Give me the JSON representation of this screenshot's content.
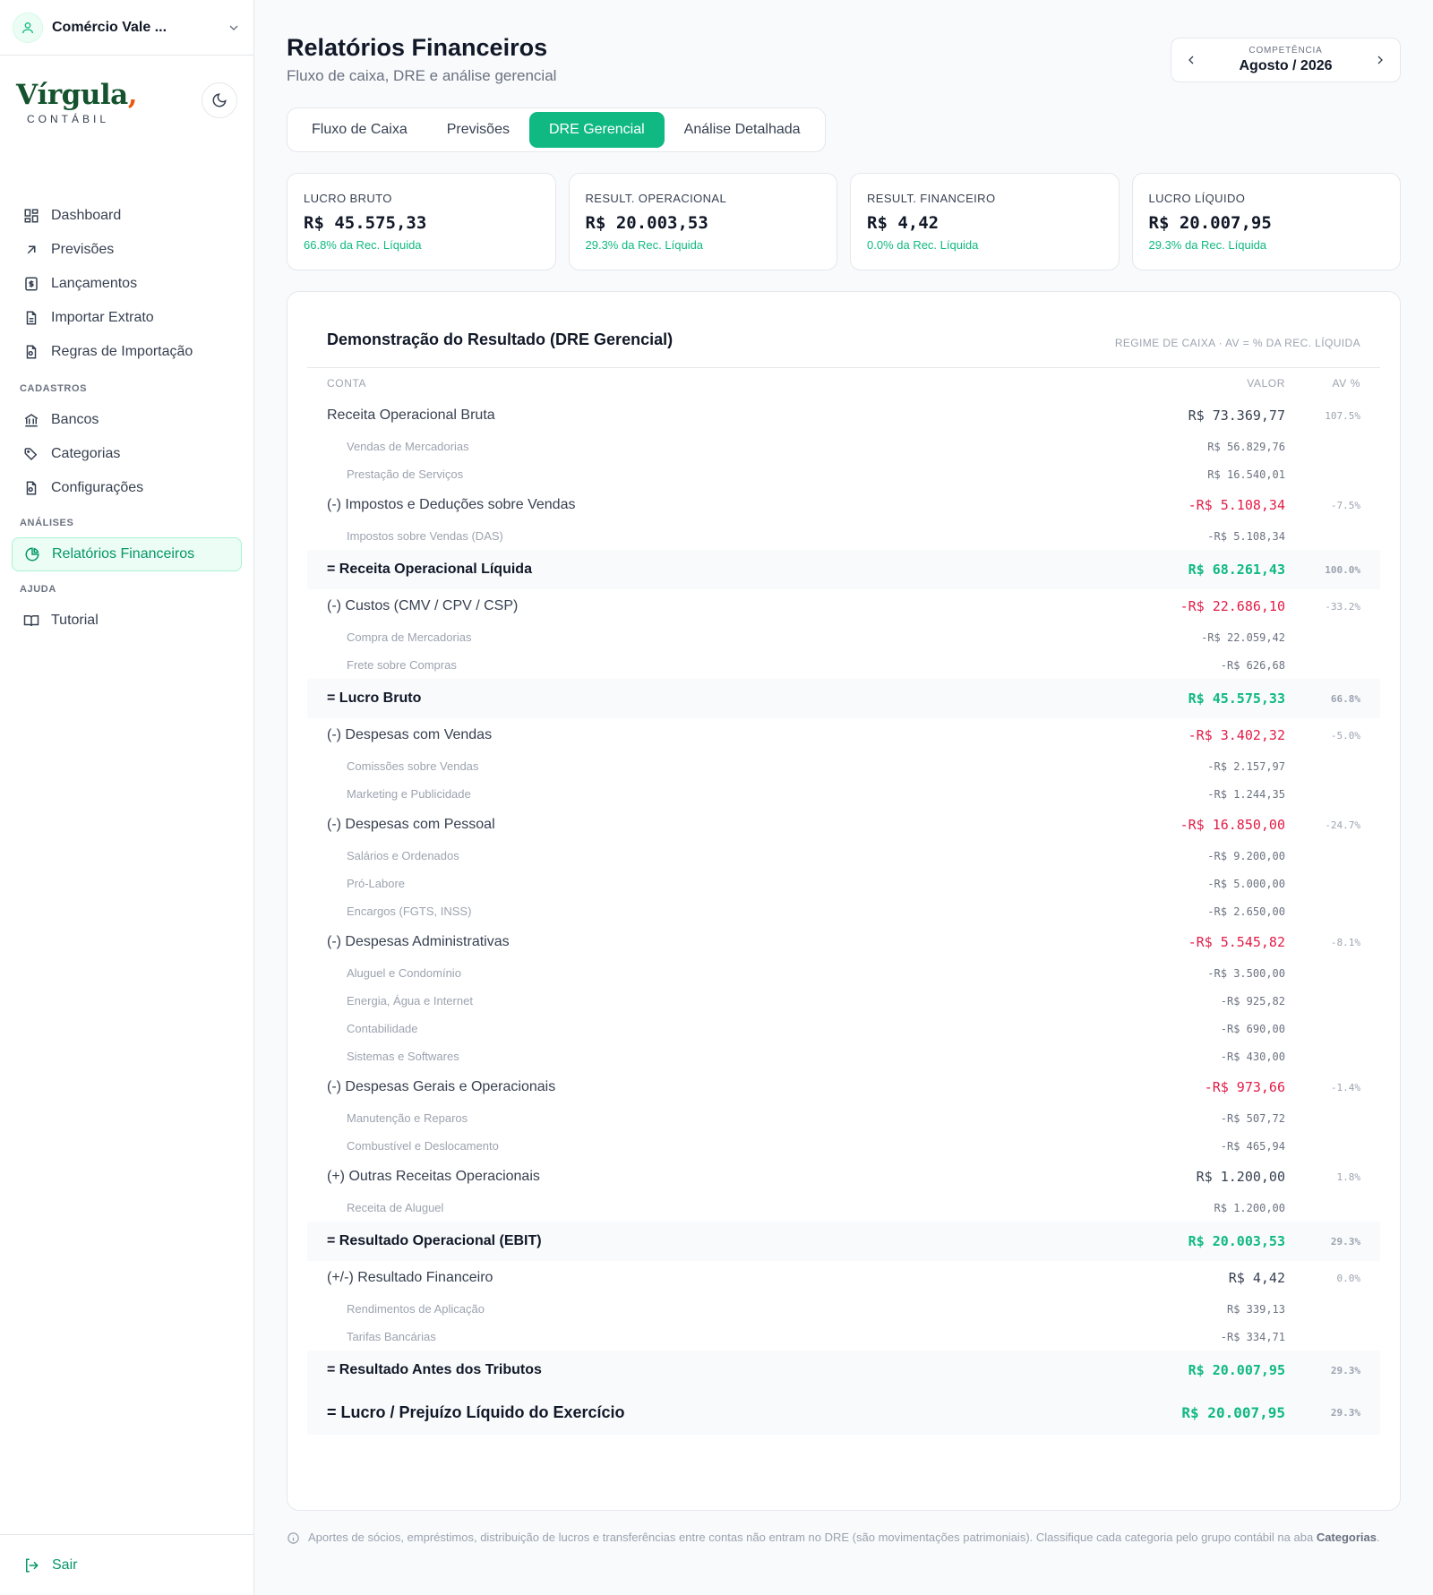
{
  "sidebar": {
    "company": "Comércio Vale ...",
    "brand": {
      "logo": "Vírgula",
      "comma": ",",
      "sub": "CONTÁBIL"
    },
    "items": [
      {
        "label": "Dashboard",
        "icon": "grid-icon"
      },
      {
        "label": "Previsões",
        "icon": "arrow-up-right-icon"
      },
      {
        "label": "Lançamentos",
        "icon": "dollar-doc-icon"
      },
      {
        "label": "Importar Extrato",
        "icon": "file-icon"
      },
      {
        "label": "Regras de Importação",
        "icon": "file-rules-icon"
      }
    ],
    "sections": {
      "cadastros": "CADASTROS",
      "analises": "ANÁLISES",
      "ajuda": "AJUDA"
    },
    "cadastros": [
      {
        "label": "Bancos",
        "icon": "bank-icon"
      },
      {
        "label": "Categorias",
        "icon": "tags-icon"
      },
      {
        "label": "Configurações",
        "icon": "settings-file-icon"
      }
    ],
    "analises": [
      {
        "label": "Relatórios Financeiros",
        "icon": "pie-chart-icon",
        "active": true
      }
    ],
    "ajuda": [
      {
        "label": "Tutorial",
        "icon": "book-icon"
      }
    ],
    "logout": "Sair"
  },
  "header": {
    "title": "Relatórios Financeiros",
    "subtitle": "Fluxo de caixa, DRE e análise gerencial",
    "period_label": "COMPETÊNCIA",
    "period_value": "Agosto / 2026"
  },
  "tabs": [
    "Fluxo de Caixa",
    "Previsões",
    "DRE Gerencial",
    "Análise Detalhada"
  ],
  "cards": [
    {
      "label": "LUCRO BRUTO",
      "value": "R$ 45.575,33",
      "note": "66.8% da Rec. Líquida"
    },
    {
      "label": "RESULT. OPERACIONAL",
      "value": "R$ 20.003,53",
      "note": "29.3% da Rec. Líquida"
    },
    {
      "label": "RESULT. FINANCEIRO",
      "value": "R$ 4,42",
      "note": "0.0% da Rec. Líquida"
    },
    {
      "label": "LUCRO LÍQUIDO",
      "value": "R$ 20.007,95",
      "note": "29.3% da Rec. Líquida"
    }
  ],
  "dre": {
    "title": "Demonstração do Resultado (DRE Gerencial)",
    "regime": "REGIME DE CAIXA · AV = % DA REC. LÍQUIDA",
    "col_account": "CONTA",
    "col_value": "VALOR",
    "col_av": "AV %",
    "rows": [
      {
        "type": "group",
        "label": "Receita Operacional Bruta",
        "value": "R$ 73.369,77",
        "av": "107.5%"
      },
      {
        "type": "sub",
        "label": "Vendas de Mercadorias",
        "value": "R$ 56.829,76"
      },
      {
        "type": "sub",
        "label": "Prestação de Serviços",
        "value": "R$ 16.540,01"
      },
      {
        "type": "group",
        "label": "(-) Impostos e Deduções sobre Vendas",
        "value": "-R$ 5.108,34",
        "av": "-7.5%",
        "neg": true
      },
      {
        "type": "sub",
        "label": "Impostos sobre Vendas (DAS)",
        "value": "-R$ 5.108,34"
      },
      {
        "type": "total",
        "label": "= Receita Operacional Líquida",
        "value": "R$ 68.261,43",
        "av": "100.0%"
      },
      {
        "type": "group",
        "label": "(-) Custos (CMV / CPV / CSP)",
        "value": "-R$ 22.686,10",
        "av": "-33.2%",
        "neg": true
      },
      {
        "type": "sub",
        "label": "Compra de Mercadorias",
        "value": "-R$ 22.059,42"
      },
      {
        "type": "sub",
        "label": "Frete sobre Compras",
        "value": "-R$ 626,68"
      },
      {
        "type": "total",
        "label": "= Lucro Bruto",
        "value": "R$ 45.575,33",
        "av": "66.8%"
      },
      {
        "type": "group",
        "label": "(-) Despesas com Vendas",
        "value": "-R$ 3.402,32",
        "av": "-5.0%",
        "neg": true
      },
      {
        "type": "sub",
        "label": "Comissões sobre Vendas",
        "value": "-R$ 2.157,97"
      },
      {
        "type": "sub",
        "label": "Marketing e Publicidade",
        "value": "-R$ 1.244,35"
      },
      {
        "type": "group",
        "label": "(-) Despesas com Pessoal",
        "value": "-R$ 16.850,00",
        "av": "-24.7%",
        "neg": true
      },
      {
        "type": "sub",
        "label": "Salários e Ordenados",
        "value": "-R$ 9.200,00"
      },
      {
        "type": "sub",
        "label": "Pró-Labore",
        "value": "-R$ 5.000,00"
      },
      {
        "type": "sub",
        "label": "Encargos (FGTS, INSS)",
        "value": "-R$ 2.650,00"
      },
      {
        "type": "group",
        "label": "(-) Despesas Administrativas",
        "value": "-R$ 5.545,82",
        "av": "-8.1%",
        "neg": true
      },
      {
        "type": "sub",
        "label": "Aluguel e Condomínio",
        "value": "-R$ 3.500,00"
      },
      {
        "type": "sub",
        "label": "Energia, Água e Internet",
        "value": "-R$ 925,82"
      },
      {
        "type": "sub",
        "label": "Contabilidade",
        "value": "-R$ 690,00"
      },
      {
        "type": "sub",
        "label": "Sistemas e Softwares",
        "value": "-R$ 430,00"
      },
      {
        "type": "group",
        "label": "(-) Despesas Gerais e Operacionais",
        "value": "-R$ 973,66",
        "av": "-1.4%",
        "neg": true
      },
      {
        "type": "sub",
        "label": "Manutenção e Reparos",
        "value": "-R$ 507,72"
      },
      {
        "type": "sub",
        "label": "Combustível e Deslocamento",
        "value": "-R$ 465,94"
      },
      {
        "type": "group",
        "label": "(+) Outras Receitas Operacionais",
        "value": "R$ 1.200,00",
        "av": "1.8%"
      },
      {
        "type": "sub",
        "label": "Receita de Aluguel",
        "value": "R$ 1.200,00"
      },
      {
        "type": "total",
        "label": "= Resultado Operacional (EBIT)",
        "value": "R$ 20.003,53",
        "av": "29.3%"
      },
      {
        "type": "group",
        "label": "(+/-) Resultado Financeiro",
        "value": "R$ 4,42",
        "av": "0.0%"
      },
      {
        "type": "sub",
        "label": "Rendimentos de Aplicação",
        "value": "R$ 339,13"
      },
      {
        "type": "sub",
        "label": "Tarifas Bancárias",
        "value": "-R$ 334,71"
      },
      {
        "type": "total",
        "label": "= Resultado Antes dos Tributos",
        "value": "R$ 20.007,95",
        "av": "29.3%"
      },
      {
        "type": "final",
        "label": "= Lucro / Prejuízo Líquido do Exercício",
        "value": "R$ 20.007,95",
        "av": "29.3%"
      }
    ]
  },
  "footnote": {
    "text": "Aportes de sócios, empréstimos, distribuição de lucros e transferências entre contas não entram no DRE (são movimentações patrimoniais). Classifique cada categoria pelo grupo contábil na aba ",
    "link": "Categorias",
    "end": "."
  },
  "colors": {
    "accent": "#10b981",
    "negative": "#e11d48",
    "brand": "#14532d",
    "brand_comma": "#ea580c"
  }
}
